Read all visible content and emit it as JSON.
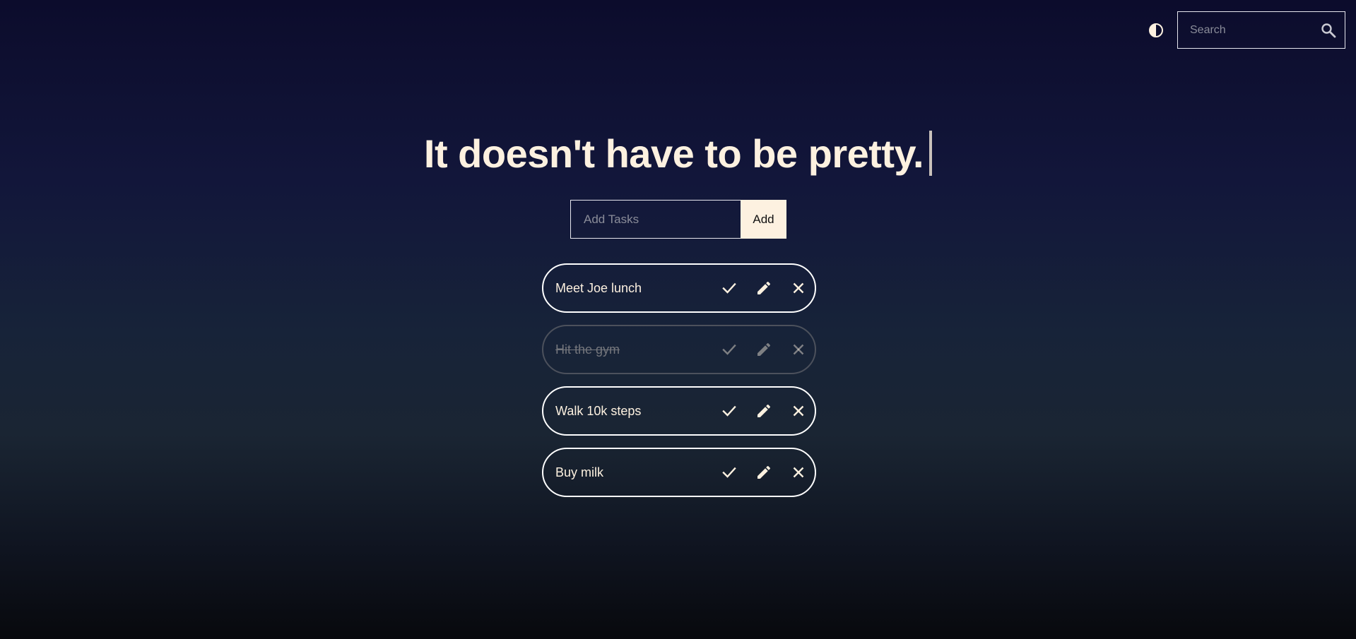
{
  "header": {
    "theme_toggle_icon": "contrast-icon",
    "search": {
      "placeholder": "Search",
      "value": "",
      "icon": "search-icon"
    }
  },
  "headline": "It doesn't have to be pretty.",
  "add_form": {
    "placeholder": "Add Tasks",
    "value": "",
    "button_label": "Add"
  },
  "tasks": [
    {
      "text": "Meet Joe lunch",
      "completed": false
    },
    {
      "text": "Hit the gym",
      "completed": true
    },
    {
      "text": "Walk 10k steps",
      "completed": false
    },
    {
      "text": "Buy milk",
      "completed": false
    }
  ],
  "task_actions": {
    "complete_icon": "check-icon",
    "edit_icon": "pencil-icon",
    "delete_icon": "close-icon"
  },
  "colors": {
    "text_cream": "#fdf1e0",
    "border_white": "#ffffff",
    "done_border": "#4c515c",
    "done_text": "#74767c",
    "bg_top": "#0c0c2c",
    "bg_bottom": "#08090d"
  }
}
